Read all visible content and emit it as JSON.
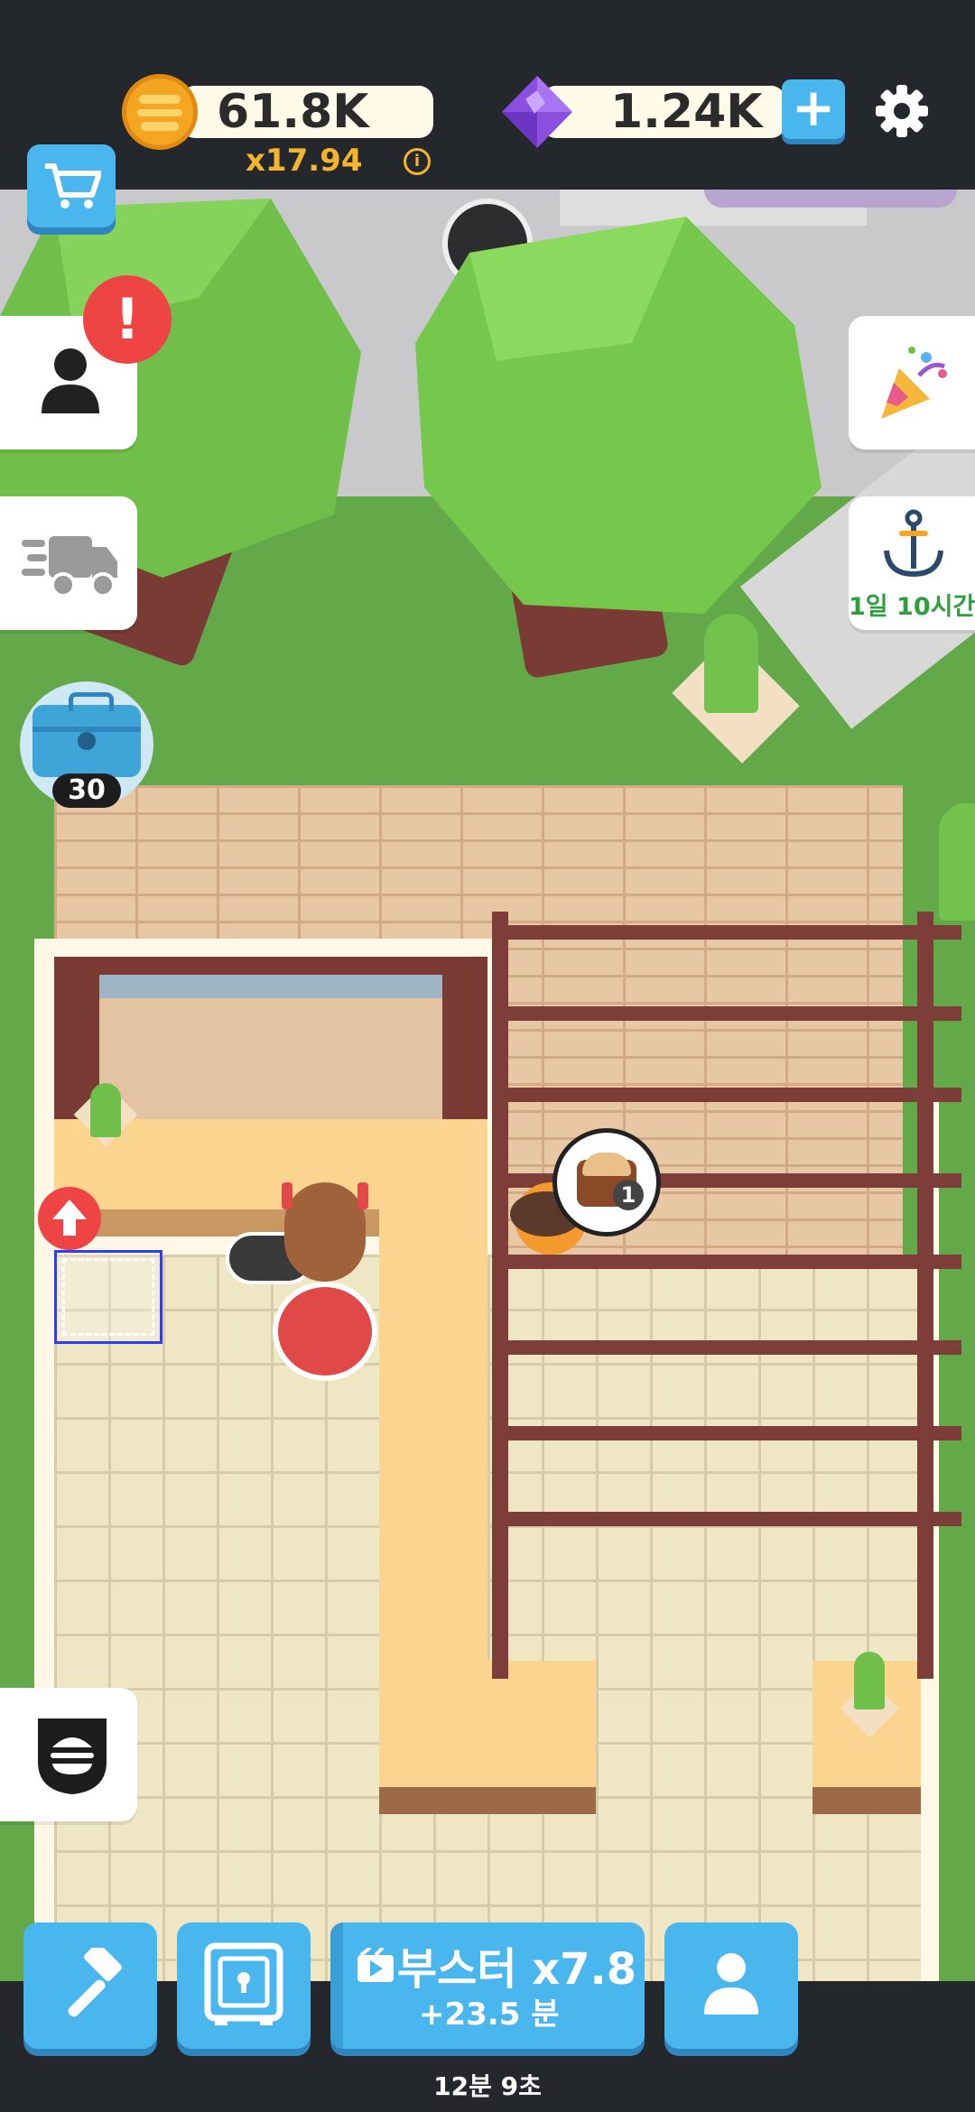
{
  "hud": {
    "coins": "61.8K",
    "multiplier": "x17.94",
    "info_glyph": "i",
    "gems": "1.24K",
    "add_glyph": "+"
  },
  "side_left": {
    "alert_glyph": "!",
    "toolbox_count": "30"
  },
  "side_right": {
    "event_timer": "1일 10시간"
  },
  "scene": {
    "order_count": "1"
  },
  "bottom": {
    "booster_label": "부스터 x7.8",
    "booster_sub": "+23.5 분",
    "timer": "12분 9초"
  },
  "colors": {
    "accent_blue": "#4ab6ee",
    "gold": "#f4a623",
    "gem_purple": "#8b4fe0",
    "alert_red": "#ee4444",
    "timer_green": "#2e9e3e"
  }
}
